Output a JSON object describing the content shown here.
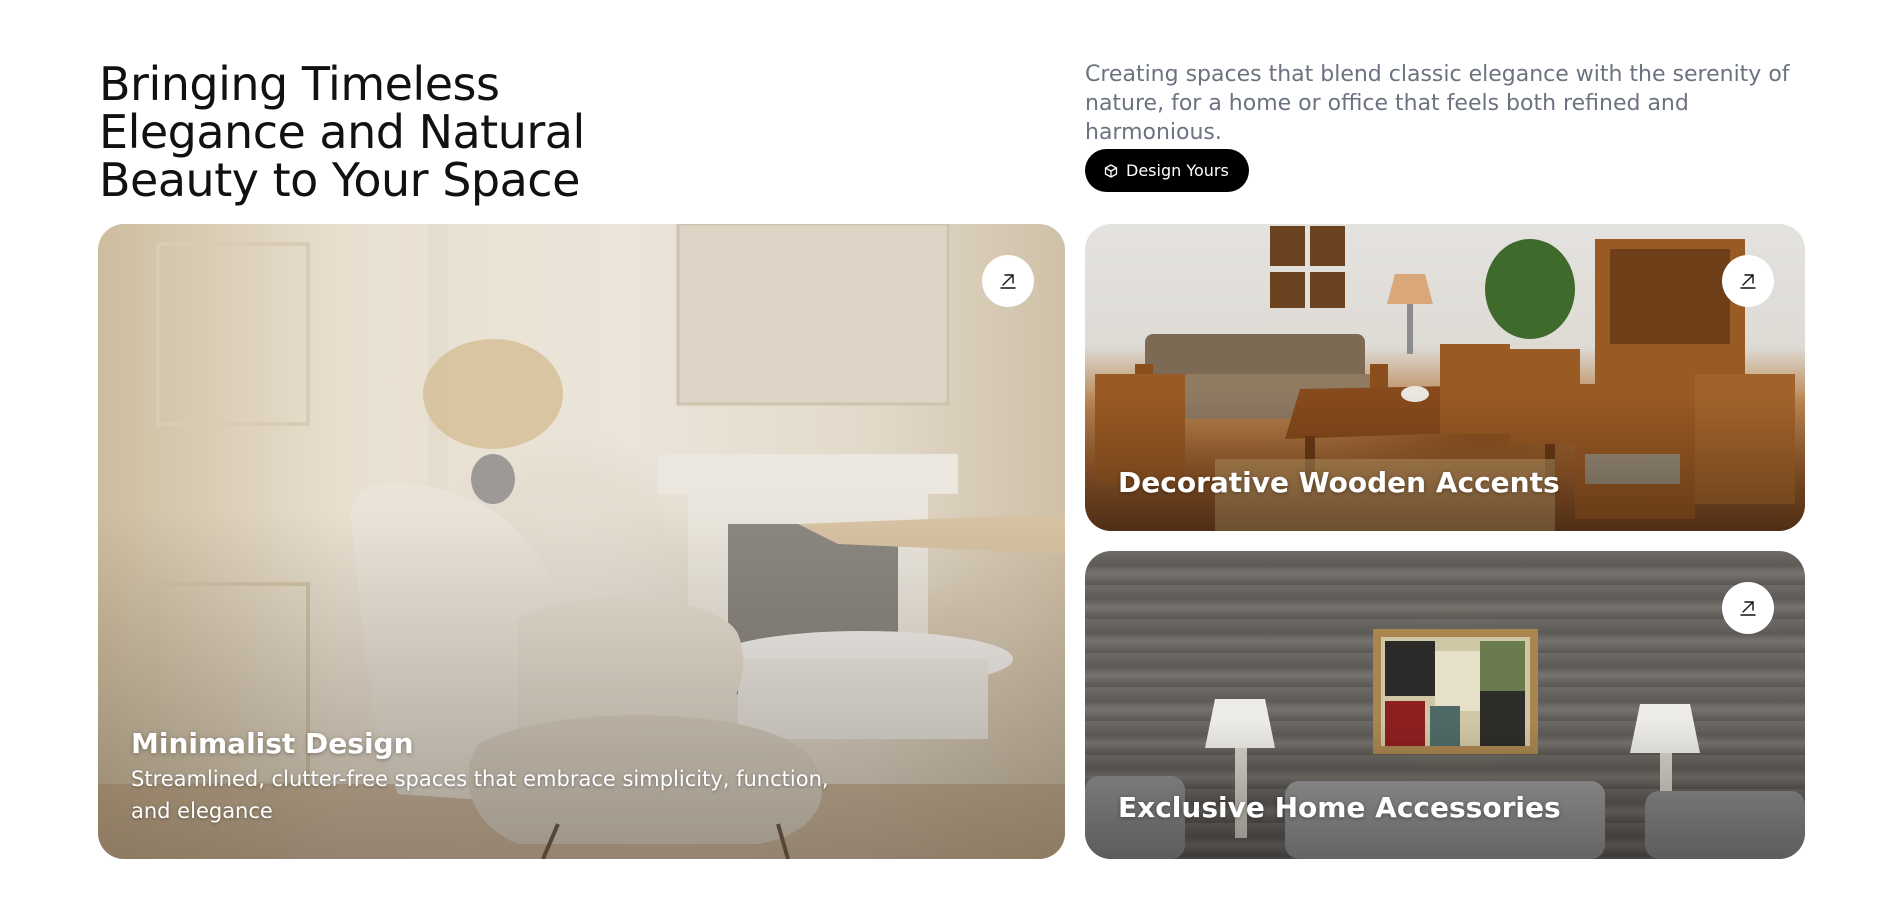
{
  "hero": {
    "headline_lines": [
      "Bringing Timeless",
      "Elegance and Natural",
      "Beauty to Your Space"
    ],
    "intro": "Creating spaces that blend classic elegance with the serenity of nature, for a home or office that feels both refined and harmonious.",
    "cta_label": "Design Yours",
    "cta_icon": "cube-icon"
  },
  "cards": [
    {
      "title": "Minimalist Design",
      "description": "Streamlined, clutter-free spaces that embrace simplicity, function, and elegance",
      "link_icon": "arrow-up-right-icon"
    },
    {
      "title": "Decorative Wooden Accents",
      "link_icon": "arrow-up-right-icon"
    },
    {
      "title": "Exclusive Home Accessories",
      "link_icon": "arrow-up-right-icon"
    }
  ],
  "colors": {
    "heading": "#111111",
    "muted_text": "#6b7280",
    "cta_background": "#000000",
    "cta_text": "#ffffff"
  }
}
